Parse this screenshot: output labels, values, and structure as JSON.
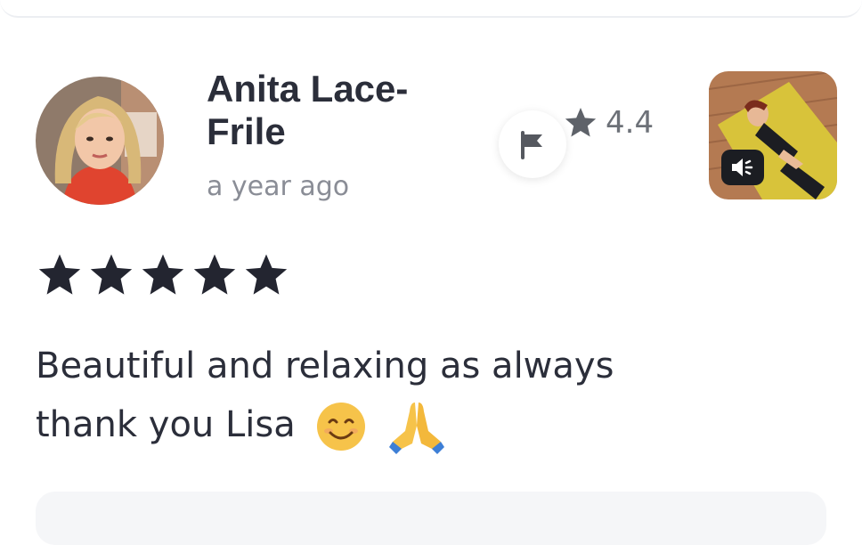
{
  "review": {
    "author_name": "Anita Lace-Frile",
    "time_ago": "a year ago",
    "session_rating": "4.4",
    "user_stars": 5,
    "text_line1": "Beautiful and relaxing as always",
    "text_line2": "thank you Lisa",
    "emojis": [
      "smiling-face",
      "folded-hands"
    ]
  },
  "icons": {
    "flag": "flag-icon",
    "rating_star": "star-icon",
    "audio": "speaker-icon"
  },
  "colors": {
    "text": "#2b2e3a",
    "muted": "#8a8d96",
    "rating_gray": "#6d7178"
  }
}
